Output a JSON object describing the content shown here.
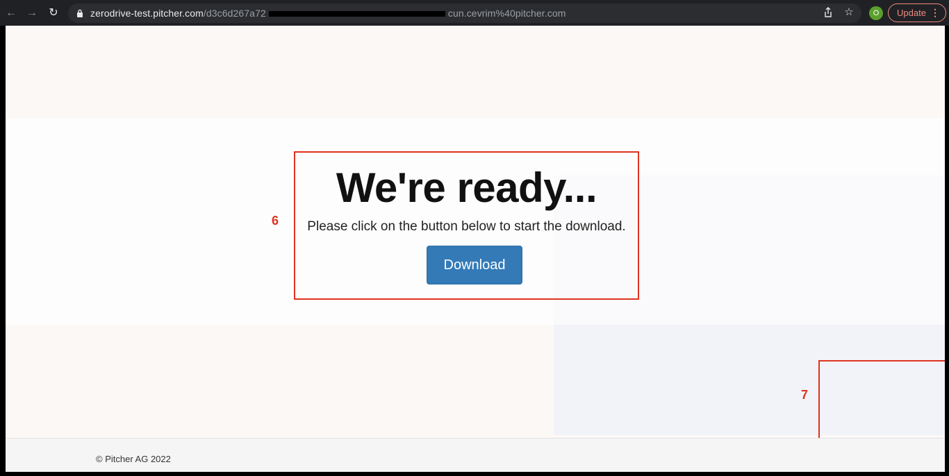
{
  "browser": {
    "url_host": "zerodrive-test.pitcher.com",
    "url_path_start": "/d3c6d267a72",
    "url_path_end": "cun.cevrim%40pitcher.com",
    "profile_initial": "O",
    "update_label": "Update",
    "icons": {
      "back": "arrow-left-icon",
      "forward": "arrow-right-icon",
      "reload": "reload-icon",
      "lock": "lock-icon",
      "share": "share-icon",
      "bookmark": "star-icon",
      "menu": "kebab-menu-icon"
    },
    "colors": {
      "toolbar": "#202124",
      "update_accent": "#f28b82",
      "avatar": "#5aa02c"
    }
  },
  "main": {
    "heading": "We're ready...",
    "subtext": "Please click on the button below to start the download.",
    "download_label": "Download"
  },
  "annotations": {
    "marker_6": "6",
    "marker_7": "7",
    "color": "#e0321f"
  },
  "footer": {
    "copyright": "© Pitcher AG 2022"
  },
  "colors": {
    "button": "#337ab7"
  }
}
